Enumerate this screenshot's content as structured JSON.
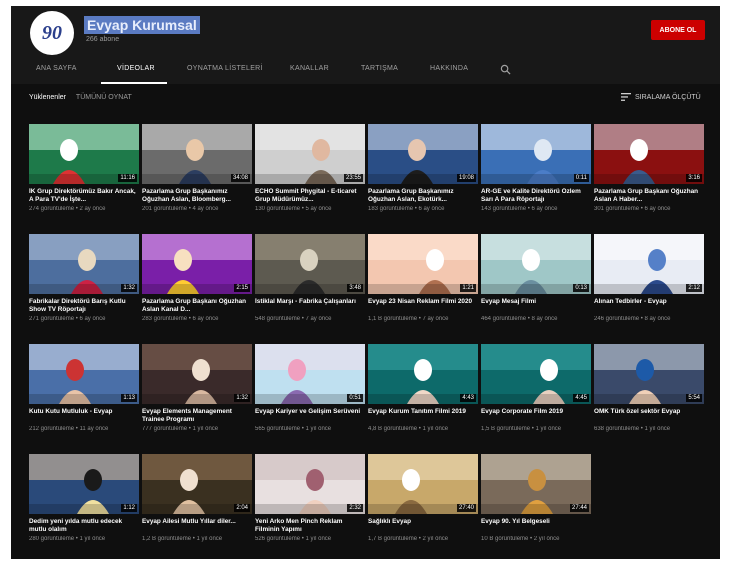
{
  "channel": {
    "name": "Evyap Kurumsal",
    "subscribers": "266 abone",
    "logo_text": "90",
    "subscribe_label": "ABONE OL"
  },
  "tabs": [
    {
      "label": "ANA SAYFA"
    },
    {
      "label": "VİDEOLAR"
    },
    {
      "label": "OYNATMA LİSTELERİ"
    },
    {
      "label": "KANALLAR"
    },
    {
      "label": "TARTIŞMA"
    },
    {
      "label": "HAKKINDA"
    }
  ],
  "filters": {
    "uploads": "Yüklenenler",
    "play_all": "TÜMÜNÜ OYNAT"
  },
  "sort_label": "SIRALAMA ÖLÇÜTÜ",
  "colors": {
    "accent": "#cc0000",
    "background": "#0f0f0f",
    "header": "#181818"
  },
  "videos": [
    {
      "title": "İK Grup Direktörümüz Bakır Ancak, A Para TV'de İşte...",
      "meta": "274 görüntüleme • 2 ay önce",
      "duration": "11:16"
    },
    {
      "title": "Pazarlama Grup Başkanımız Oğuzhan Aslan, Bloomberg...",
      "meta": "201 görüntüleme • 4 ay önce",
      "duration": "34:08"
    },
    {
      "title": "ECHO Summit Phygital - E-ticaret Grup Müdürümüz...",
      "meta": "130 görüntüleme • 5 ay önce",
      "duration": "23:55"
    },
    {
      "title": "Pazarlama Grup Başkanımız Oğuzhan Aslan, Ekotürk...",
      "meta": "183 görüntüleme • 6 ay önce",
      "duration": "19:08"
    },
    {
      "title": "AR-GE ve Kalite Direktörü Özlem Sarı A Para Röportajı",
      "meta": "143 görüntüleme • 6 ay önce",
      "duration": "0:11"
    },
    {
      "title": "Pazarlama Grup Başkanı Oğuzhan Aslan A Haber...",
      "meta": "301 görüntüleme • 6 ay önce",
      "duration": "3:16"
    },
    {
      "title": "Fabrikalar Direktörü Barış Kutlu Show TV Röportajı",
      "meta": "271 görüntüleme • 6 ay önce",
      "duration": "1:32"
    },
    {
      "title": "Pazarlama Grup Başkanı Oğuzhan Aslan Kanal D...",
      "meta": "283 görüntüleme • 6 ay önce",
      "duration": "2:15"
    },
    {
      "title": "İstiklal Marşı - Fabrika Çalışanları",
      "meta": "548 görüntüleme • 7 ay önce",
      "duration": "3:48"
    },
    {
      "title": "Evyap 23 Nisan Reklam Filmi 2020",
      "meta": "1,1 B görüntüleme • 7 ay önce",
      "duration": "1:21"
    },
    {
      "title": "Evyap Mesaj Filmi",
      "meta": "464 görüntüleme • 8 ay önce",
      "duration": "0:13"
    },
    {
      "title": "Alınan Tedbirler - Evyap",
      "meta": "246 görüntüleme • 8 ay önce",
      "duration": "2:12"
    },
    {
      "title": "Kutu Kutu Mutluluk - Evyap",
      "meta": "212 görüntüleme • 11 ay önce",
      "duration": "1:13"
    },
    {
      "title": "Evyap Elements Management Trainee Programı",
      "meta": "777 görüntüleme • 1 yıl önce",
      "duration": "1:32"
    },
    {
      "title": "Evyap Kariyer ve Gelişim Serüveni",
      "meta": "565 görüntüleme • 1 yıl önce",
      "duration": "0:51"
    },
    {
      "title": "Evyap Kurum Tanıtım Filmi 2019",
      "meta": "4,8 B görüntüleme • 1 yıl önce",
      "duration": "4:43"
    },
    {
      "title": "Evyap Corporate Film 2019",
      "meta": "1,5 B görüntüleme • 1 yıl önce",
      "duration": "4:45"
    },
    {
      "title": "OMK Türk özel sektör Evyap",
      "meta": "638 görüntüleme • 1 yıl önce",
      "duration": "5:54"
    },
    {
      "title": "Dedim yeni yılda mutlu edecek mutlu olalım",
      "meta": "280 görüntüleme • 1 yıl önce",
      "duration": "1:12"
    },
    {
      "title": "Evyap Ailesi Mutlu Yıllar diler...",
      "meta": "1,2 B görüntüleme • 1 yıl önce",
      "duration": "2:04"
    },
    {
      "title": "Yeni Arko Men Pinch Reklam Filminin Yapımı",
      "meta": "526 görüntüleme • 1 yıl önce",
      "duration": "2:32"
    },
    {
      "title": "Sağlıklı Evyap",
      "meta": "1,7 B görüntüleme • 2 yıl önce",
      "duration": "27:40"
    },
    {
      "title": "Evyap 90. Yıl Belgeseli",
      "meta": "10 B görüntüleme • 2 yıl önce",
      "duration": "27:44"
    }
  ]
}
